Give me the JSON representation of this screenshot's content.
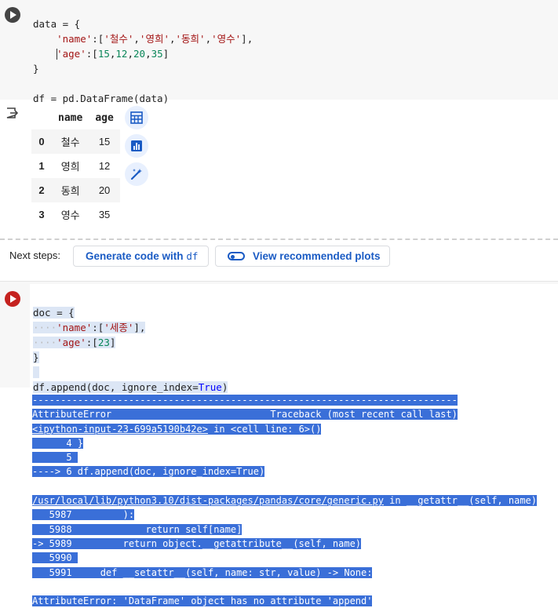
{
  "cell1": {
    "code_lines": [
      "data = {",
      "    'name':['철수','영희','동희','영수'],",
      "    'age':[15,12,20,35]",
      "}",
      "",
      "df = pd.DataFrame(data)"
    ],
    "run_button": "run-cell"
  },
  "output": {
    "columns": [
      "",
      "name",
      "age"
    ],
    "rows": [
      {
        "index": "0",
        "name": "철수",
        "age": "15"
      },
      {
        "index": "1",
        "name": "영희",
        "age": "12"
      },
      {
        "index": "2",
        "name": "동희",
        "age": "20"
      },
      {
        "index": "3",
        "name": "영수",
        "age": "35"
      }
    ],
    "icons": [
      "table-icon",
      "chart-icon",
      "magic-wand-icon"
    ]
  },
  "next_steps": {
    "label": "Next steps:",
    "generate_prefix": "Generate code with",
    "generate_var": "df",
    "view_plots": "View recommended plots"
  },
  "cell2": {
    "code_lines": [
      "doc = {",
      "    'name':['세종'],",
      "    'age':[23]",
      "}",
      "",
      "df.append(doc, ignore_index=True)"
    ]
  },
  "error": {
    "lines": [
      "---------------------------------------------------------------------------",
      "AttributeError                            Traceback (most recent call last)",
      "<ipython-input-23-699a5190b42e> in <cell line: 6>()",
      "      4 }",
      "      5 ",
      "----> 6 df.append(doc, ignore_index=True)",
      "",
      "/usr/local/lib/python3.10/dist-packages/pandas/core/generic.py in __getattr__(self, name)",
      "   5987         ):",
      "   5988             return self[name]",
      "-> 5989         return object.__getattribute__(self, name)",
      "   5990 ",
      "   5991     def __setattr__(self, name: str, value) -> None:",
      "",
      "AttributeError: 'DataFrame' object has no attribute 'append'"
    ]
  },
  "colors": {
    "selection": "#3a6fd8",
    "link": "#1a5bc4",
    "error_run": "#c5221f"
  }
}
